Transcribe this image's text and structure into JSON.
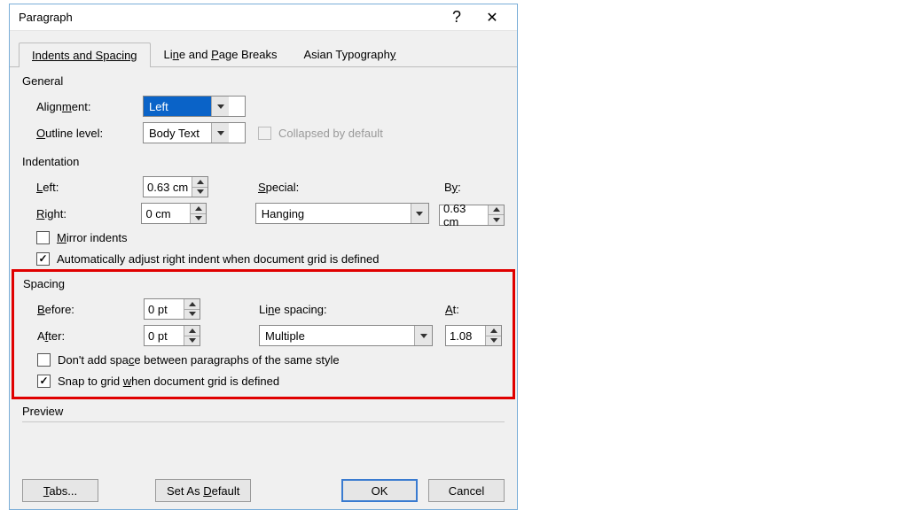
{
  "title": "Paragraph",
  "help_symbol": "?",
  "close_symbol": "✕",
  "tabs": {
    "indents": "Indents and Spacing",
    "lineBreaks": "Line and Page Breaks",
    "asian": "Asian Typography"
  },
  "general": {
    "group": "General",
    "alignment_label_pre": "Align",
    "alignment_label_u": "m",
    "alignment_label_post": "ent:",
    "alignment_value": "Left",
    "outline_u": "O",
    "outline_post": "utline level:",
    "outline_value": "Body Text",
    "collapsed_u": "E",
    "collapsed_label": "Collapsed by default"
  },
  "indentation": {
    "group": "Indentation",
    "left_u": "L",
    "left_post": "eft:",
    "left_value": "0.63 cm",
    "right_u": "R",
    "right_post": "ight:",
    "right_value": "0 cm",
    "special_u": "S",
    "special_post": "pecial:",
    "special_value": "Hanging",
    "by_label": "By:",
    "by_u": "y",
    "by_value": "0.63 cm",
    "mirror_u": "M",
    "mirror_label": "irror indents",
    "auto_pre": "Automatically ad",
    "auto_u": "j",
    "auto_post": "ust right indent when document grid is defined"
  },
  "spacing": {
    "group": "Spacing",
    "before_u": "B",
    "before_post": "efore:",
    "before_value": "0 pt",
    "after_pre": "A",
    "after_u": "f",
    "after_post": "ter:",
    "after_value": "0 pt",
    "linespacing_label": "Line spacing:",
    "linespacing_u_pre": "Li",
    "linespacing_u": "n",
    "linespacing_u_post": "e spacing:",
    "linespacing_value": "Multiple",
    "at_u": "A",
    "at_post": "t:",
    "at_value": "1.08",
    "dont_pre": "Don't add spa",
    "dont_u": "c",
    "dont_post": "e between paragraphs of the same style",
    "snap_pre": "Snap to grid ",
    "snap_u": "w",
    "snap_post": "hen document grid is defined"
  },
  "preview": "Preview",
  "buttons": {
    "tabs": "Tabs...",
    "tabs_u": "T",
    "tabs_post": "abs...",
    "default_pre": "Set As ",
    "default_u": "D",
    "default_post": "efault",
    "ok": "OK",
    "cancel": "Cancel"
  }
}
